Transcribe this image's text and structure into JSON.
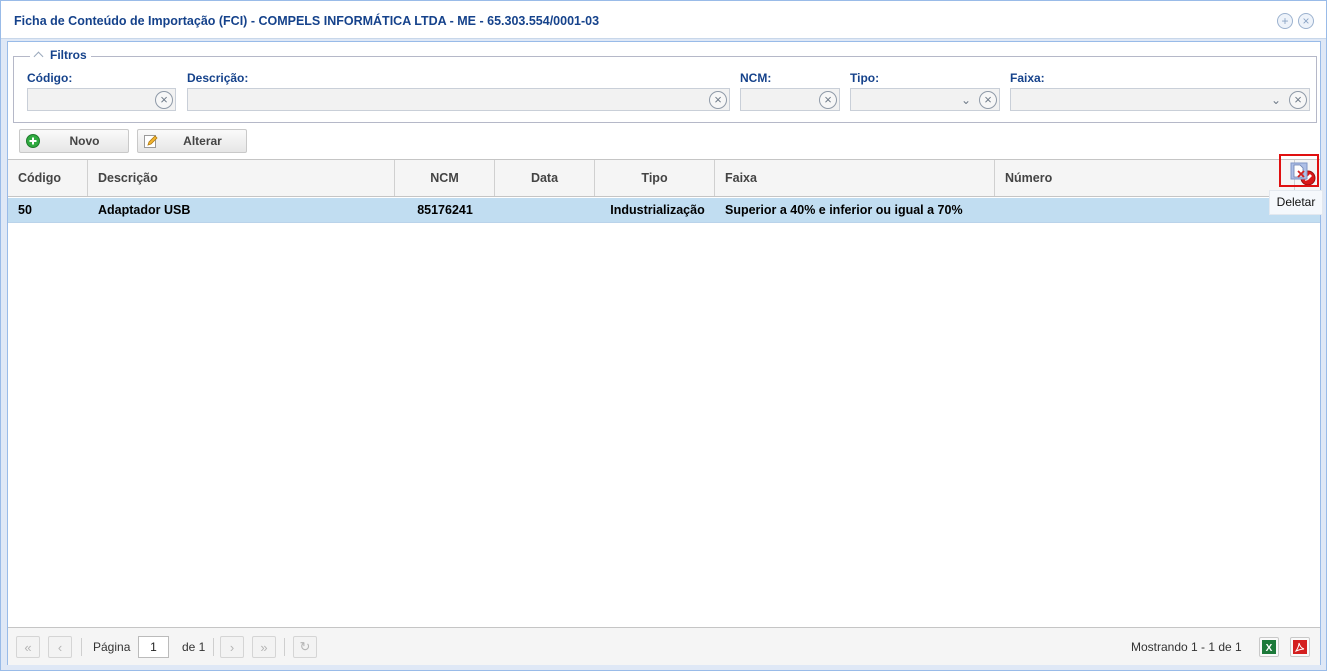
{
  "window": {
    "title": "Ficha de Conteúdo de Importação (FCI) - COMPELS INFORMÁTICA LTDA - ME - 65.303.554/0001-03",
    "tools": [
      "add-circle-icon",
      "close-circle-icon"
    ]
  },
  "filters": {
    "legend": "Filtros",
    "codigo_label": "Código:",
    "descricao_label": "Descrição:",
    "ncm_label": "NCM:",
    "tipo_label": "Tipo:",
    "faixa_label": "Faixa:",
    "codigo_value": "",
    "descricao_value": "",
    "ncm_value": "",
    "tipo_value": "",
    "faixa_value": ""
  },
  "toolbar": {
    "novo_label": "Novo",
    "alterar_label": "Alterar"
  },
  "grid": {
    "columns": [
      "Código",
      "Descrição",
      "NCM",
      "Data",
      "Tipo",
      "Faixa",
      "Número"
    ],
    "rows": [
      {
        "codigo": "50",
        "descricao": "Adaptador USB",
        "ncm": "85176241",
        "data": "",
        "tipo": "Industrialização",
        "faixa": "Superior a 40% e inferior ou igual a 70%",
        "numero": ""
      }
    ],
    "delete_tooltip": "Deletar"
  },
  "paging": {
    "page_label": "Página",
    "page_value": "1",
    "of_label": "de 1",
    "display_info": "Mostrando 1 - 1 de 1"
  },
  "colors": {
    "title": "#15428b",
    "selected_row": "#c1ddf1",
    "highlight": "#e01010",
    "excel": "#1d7a3a",
    "pdf": "#d42020"
  }
}
